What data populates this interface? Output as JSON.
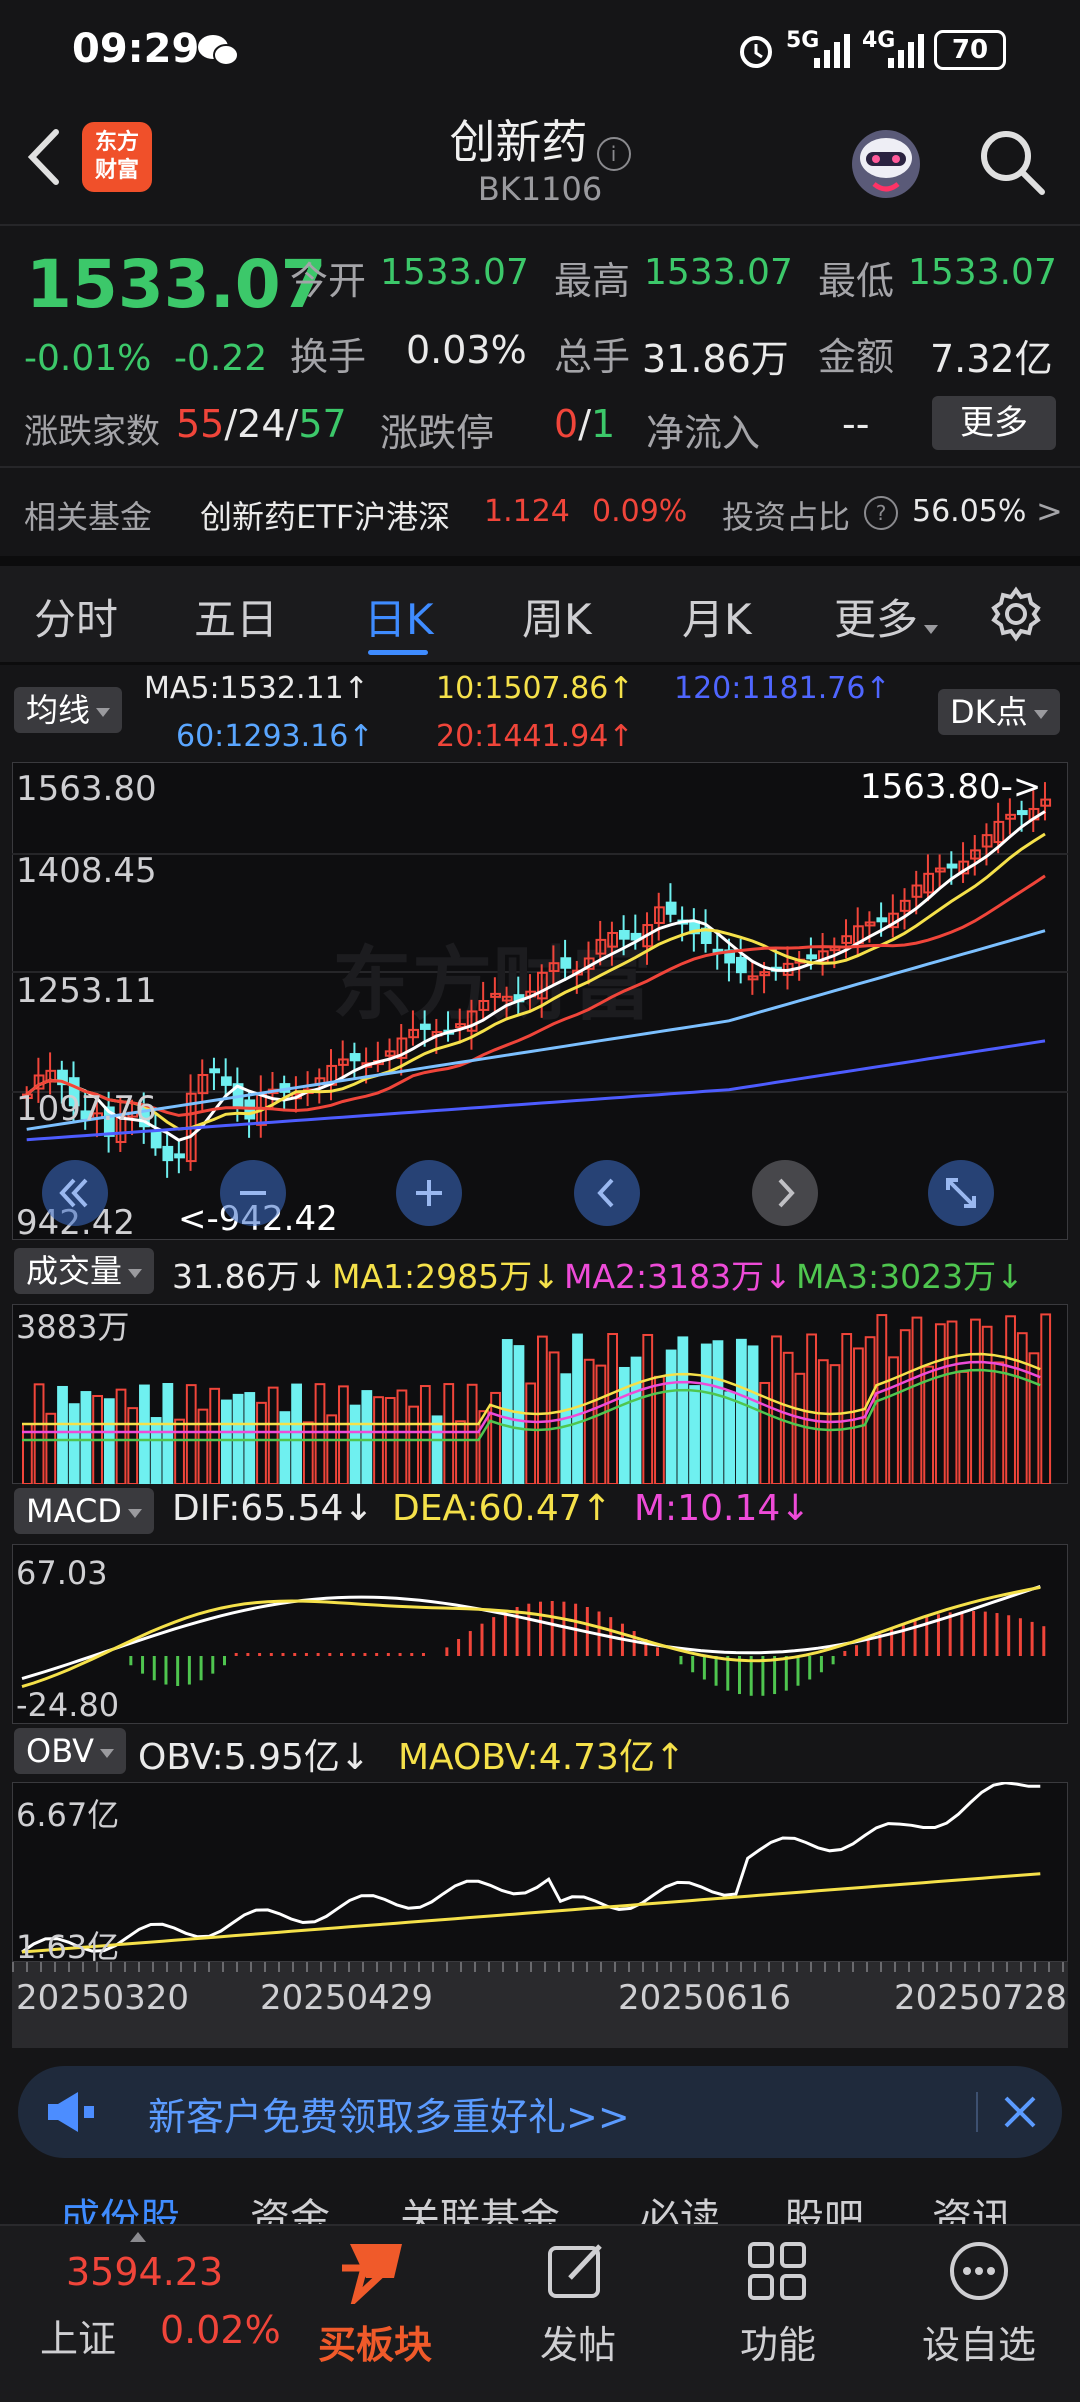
{
  "status": {
    "time": "09:29",
    "sig1": "5G",
    "sig2": "4G",
    "battery": "70"
  },
  "header": {
    "logo_line1": "东方",
    "logo_line2": "财富",
    "title": "创新药",
    "code": "BK1106",
    "info": "i"
  },
  "quote": {
    "price": "1533.07",
    "change_pct": "-0.01%",
    "change": "-0.22",
    "open_label": "今开",
    "open": "1533.07",
    "high_label": "最高",
    "high": "1533.07",
    "low_label": "最低",
    "low": "1533.07",
    "turnover_label": "换手",
    "turnover": "0.03%",
    "volume_label": "总手",
    "volume": "31.86万",
    "amount_label": "金额",
    "amount": "7.32亿",
    "breadth_label": "涨跌家数",
    "up": "55",
    "flat": "24",
    "down": "57",
    "slash": "/",
    "limit_label": "涨跌停",
    "limit_up": "0",
    "limit_down": "1",
    "netflow_label": "净流入",
    "netflow": "--",
    "more": "更多"
  },
  "fund": {
    "label": "相关基金",
    "name": "创新药ETF沪港深",
    "price": "1.124",
    "pct": "0.09%",
    "ratio_label": "投资占比",
    "help": "?",
    "ratio": "56.05%",
    "arrow": ">"
  },
  "tabs": [
    "分时",
    "五日",
    "日K",
    "周K",
    "月K",
    "更多"
  ],
  "active_tab": 2,
  "ma": {
    "btn": "均线",
    "ma5": "MA5:1532.11↑",
    "ma10": "10:1507.86↑",
    "ma120": "120:1181.76↑",
    "ma60": "60:1293.16↑",
    "ma20": "20:1441.94↑",
    "dk": "DK点"
  },
  "price_axis": {
    "a": "1563.80",
    "b": "1408.45",
    "c": "1253.11",
    "d": "1097.76",
    "e": "942.42",
    "high_tag": "1563.80->",
    "low_tag": "<-942.42"
  },
  "watermark": "东方财富",
  "vol": {
    "btn": "成交量",
    "v": "31.86万↓",
    "ma1": "MA1:2985万↓",
    "ma2": "MA2:3183万↓",
    "ma3": "MA3:3023万↓",
    "axis": "3883万"
  },
  "macd": {
    "btn": "MACD",
    "dif": "DIF:65.54↓",
    "dea": "DEA:60.47↑",
    "m": "M:10.14↓",
    "top": "67.03",
    "bottom": "-24.80"
  },
  "obv": {
    "btn": "OBV",
    "obv": "OBV:5.95亿↓",
    "maobv": "MAOBV:4.73亿↑",
    "top": "6.67亿",
    "bottom": "1.63亿"
  },
  "dates": [
    "20250320",
    "20250429",
    "20250616",
    "20250728"
  ],
  "banner": {
    "text": "新客户免费领取多重好礼>>"
  },
  "subtabs": [
    "成份股",
    "资金",
    "关联基金",
    "必读",
    "股吧",
    "资讯"
  ],
  "bottom": {
    "index_price": "3594.23",
    "index_name": "上证",
    "index_pct": "0.02%",
    "buy": "买板块",
    "post": "发帖",
    "func": "功能",
    "fav": "设自选"
  },
  "colors": {
    "up": "#f0453a",
    "down": "#3cc86a",
    "accent": "#3f8cff",
    "cyan_bar": "#6ff0f0"
  }
}
